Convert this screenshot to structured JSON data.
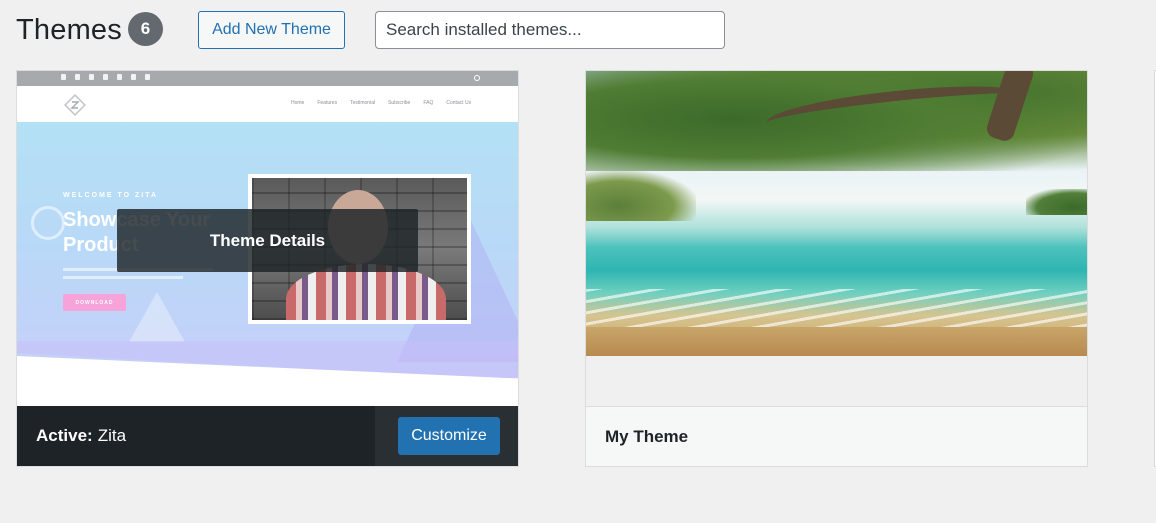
{
  "header": {
    "title": "Themes",
    "count": "6",
    "add_new_label": "Add New Theme",
    "search_placeholder": "Search installed themes..."
  },
  "themes": [
    {
      "name": "Zita",
      "active": true,
      "active_prefix": "Active:",
      "overlay_label": "Theme Details",
      "customize_label": "Customize",
      "preview": {
        "menu": [
          "Home",
          "Features",
          "Testimonial",
          "Subscribe",
          "FAQ",
          "Contact Us"
        ],
        "welcome": "WELCOME TO ZITA",
        "headline": "Showcase Your Product",
        "download": "DOWNLOAD"
      }
    },
    {
      "name": "My Theme",
      "active": false
    }
  ],
  "colors": {
    "accent": "#2271b1",
    "badge": "#646970",
    "active_bar": "#1d2327",
    "background": "#f0f0f1"
  }
}
